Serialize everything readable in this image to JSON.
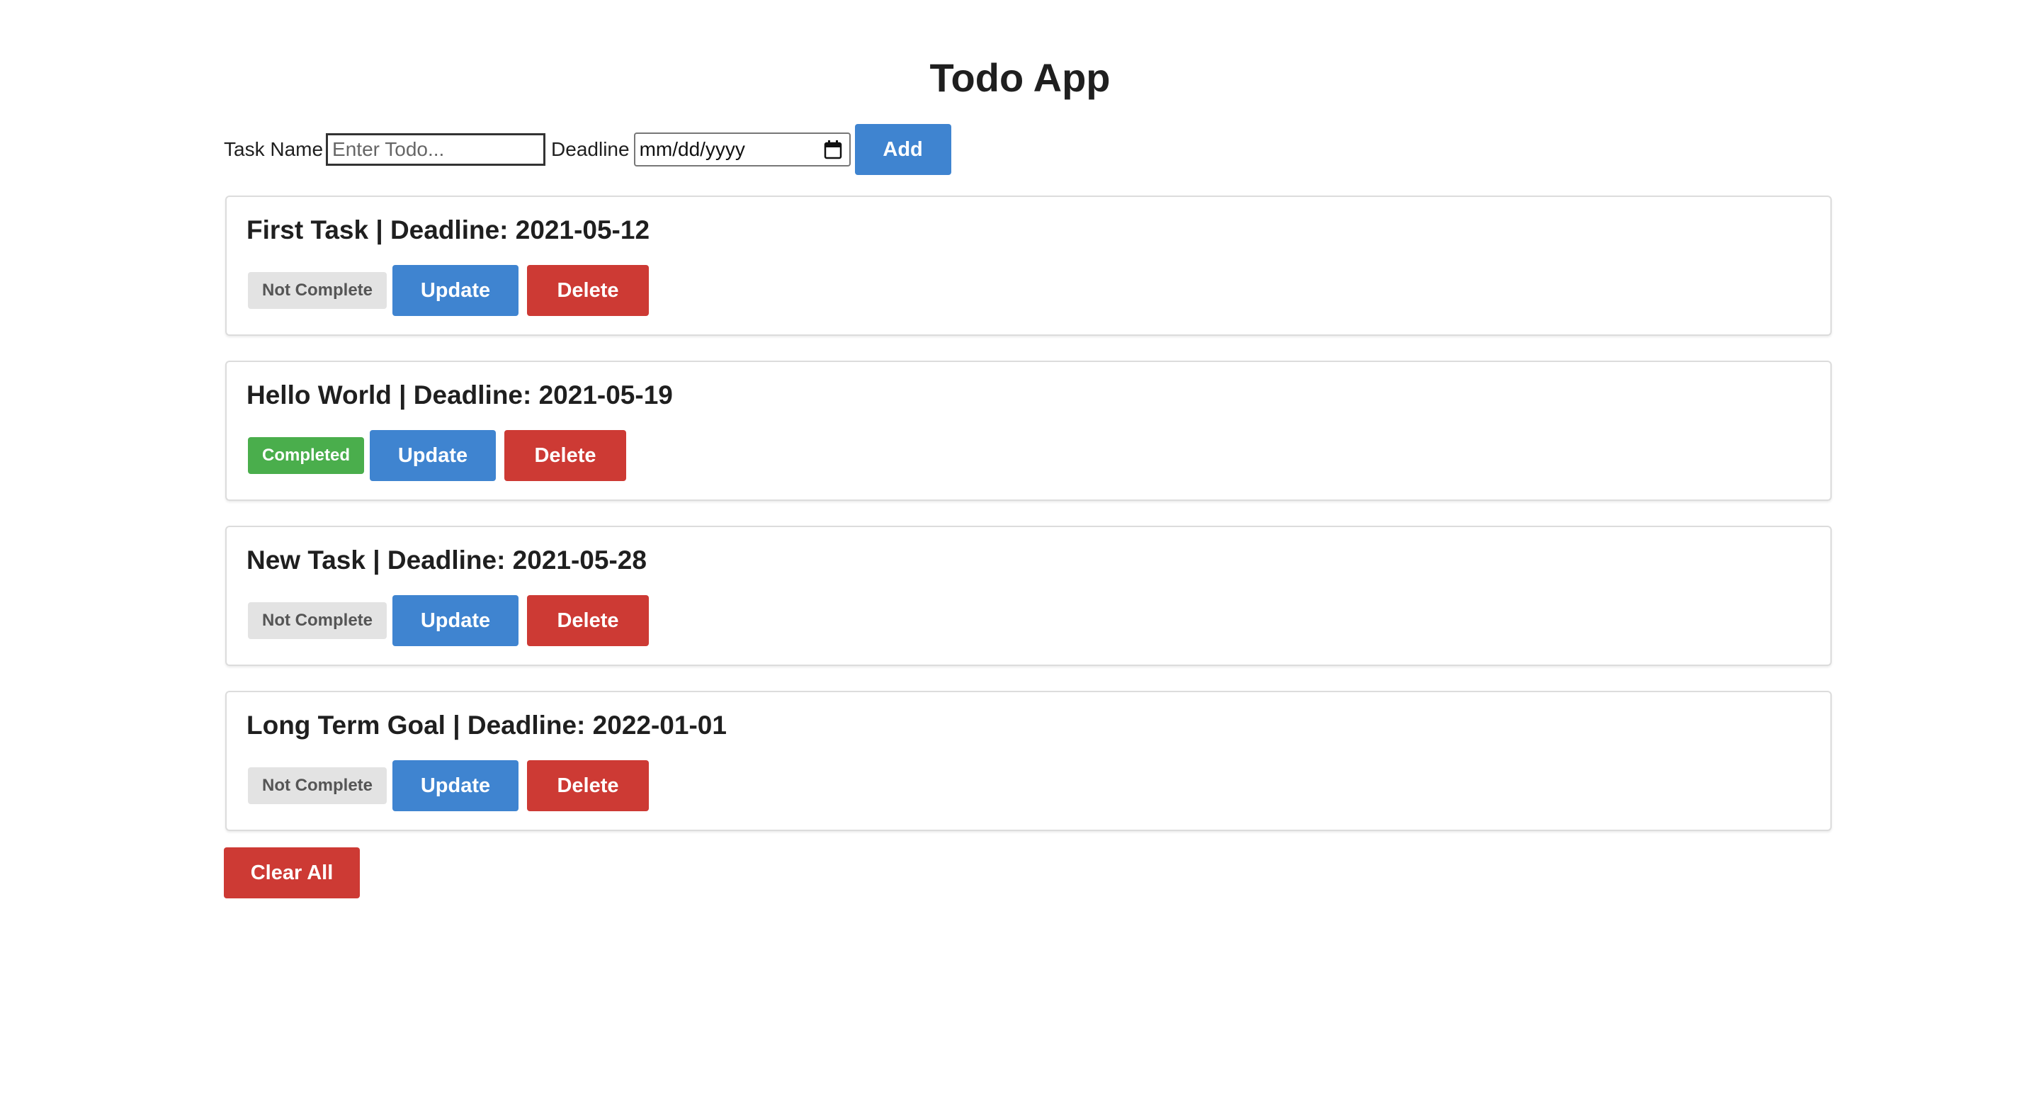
{
  "app": {
    "title": "Todo App"
  },
  "form": {
    "task_label": "Task Name",
    "task_placeholder": "Enter Todo...",
    "task_value": "",
    "deadline_label": "Deadline",
    "deadline_value": "mm/dd/yyyy",
    "add_label": "Add",
    "calendar_icon": "calendar-icon"
  },
  "todos": [
    {
      "title": "First Task | Deadline: 2021-05-12",
      "status": "Not Complete",
      "completed": false,
      "update_label": "Update",
      "delete_label": "Delete"
    },
    {
      "title": "Hello World | Deadline: 2021-05-19",
      "status": "Completed",
      "completed": true,
      "update_label": "Update",
      "delete_label": "Delete"
    },
    {
      "title": "New Task | Deadline: 2021-05-28",
      "status": "Not Complete",
      "completed": false,
      "update_label": "Update",
      "delete_label": "Delete"
    },
    {
      "title": "Long Term Goal | Deadline: 2022-01-01",
      "status": "Not Complete",
      "completed": false,
      "update_label": "Update",
      "delete_label": "Delete"
    }
  ],
  "clear_all_label": "Clear All",
  "colors": {
    "primary": "#3f84d0",
    "danger": "#cd3a34",
    "success": "#4aae4c",
    "neutral_badge": "#e3e3e3"
  }
}
